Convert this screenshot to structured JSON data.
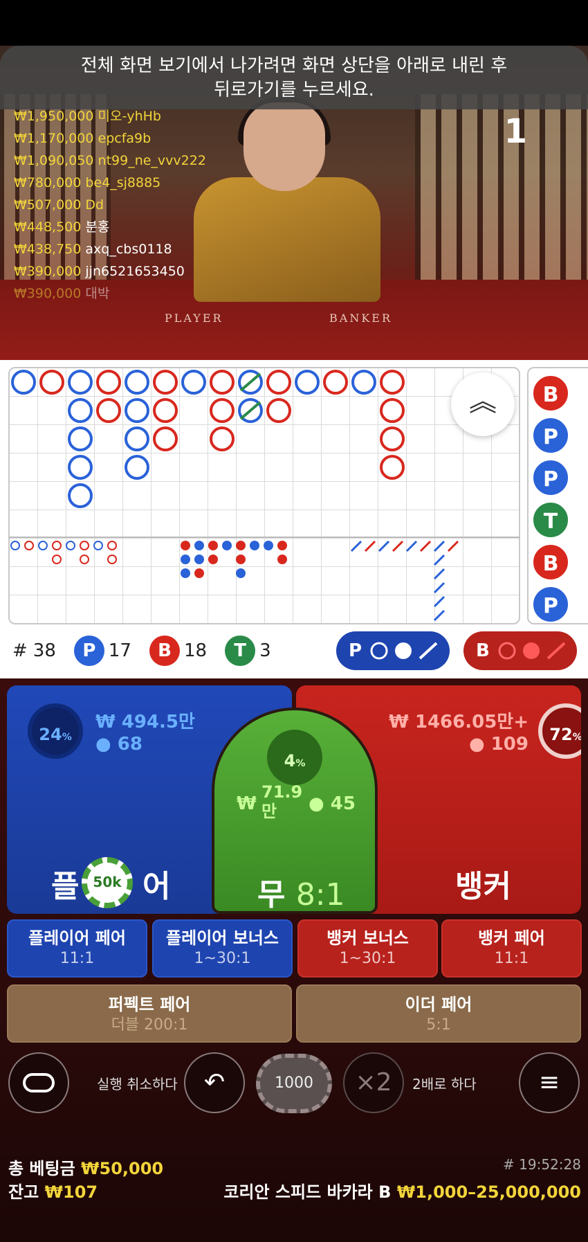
{
  "notice": {
    "line1": "전체 화면 보기에서 나가려면 화면 상단을 아래로 내린 후",
    "line2": "뒤로가기를 누르세요."
  },
  "round_indicator": "1",
  "table_labels": {
    "player": "PLAYER",
    "banker": "BANKER"
  },
  "leaderboard": [
    {
      "amount": "₩1,950,000",
      "name": "미오-yhHb"
    },
    {
      "amount": "₩1,170,000",
      "name": "epcfa9b"
    },
    {
      "amount": "₩1,090,050",
      "name": "nt99_ne_vvv222"
    },
    {
      "amount": "₩780,000",
      "name": "be4_sj8885"
    },
    {
      "amount": "₩507,000",
      "name": "Dd"
    },
    {
      "amount": "₩448,500",
      "name": "분홍"
    },
    {
      "amount": "₩438,750",
      "name": "axq_cbs0118"
    },
    {
      "amount": "₩390,000",
      "name": "jjn6521653450"
    },
    {
      "amount": "₩390,000",
      "name": "대박"
    }
  ],
  "bead_road": [
    "B",
    "P",
    "P",
    "T",
    "B",
    "P"
  ],
  "colors": {
    "player": "#2a62d8",
    "banker": "#d8281e",
    "tie": "#2a8a48",
    "gold": "#f2d53a"
  },
  "stats": {
    "total_label": "#",
    "total": "38",
    "player_letter": "P",
    "player_count": "17",
    "banker_letter": "B",
    "banker_count": "18",
    "tie_letter": "T",
    "tie_count": "3"
  },
  "predict": {
    "player": "P",
    "banker": "B"
  },
  "player_zone": {
    "pct": "24",
    "pct_unit": "%",
    "amount": "₩ 494.5만",
    "players": "68",
    "title_a": "플",
    "title_b": "어",
    "chip": "50k"
  },
  "banker_zone": {
    "pct": "72",
    "pct_unit": "%",
    "amount": "₩ 1466.05만+",
    "players": "109",
    "title": "뱅커"
  },
  "tie_zone": {
    "pct": "4",
    "pct_unit": "%",
    "amount_a": "₩",
    "amount_b": "71.9",
    "amount_c": "만",
    "players": "45",
    "title": "무",
    "odds": "8:1"
  },
  "side_bets": [
    {
      "label": "플레이어 페어",
      "odds": "11:1"
    },
    {
      "label": "플레이어 보너스",
      "odds": "1~30:1"
    },
    {
      "label": "뱅커 보너스",
      "odds": "1~30:1"
    },
    {
      "label": "뱅커 페어",
      "odds": "11:1"
    }
  ],
  "perfect_pair": {
    "label": "퍼펙트 페어",
    "odds": "더블 200:1"
  },
  "either_pair": {
    "label": "이더 페어",
    "odds": "5:1"
  },
  "controls": {
    "undo_label": "실행 취소하다",
    "chip_value": "1000",
    "double_label": "2배로 하다",
    "double_icon": "×2"
  },
  "footer": {
    "total_bet_label": "총 베팅금",
    "total_bet": "₩50,000",
    "balance_label": "잔고",
    "balance": "₩107",
    "game_id": "# 19:52:28",
    "table_name": "코리안 스피드 바카라 B",
    "limits": "₩1,000–25,000,000"
  }
}
